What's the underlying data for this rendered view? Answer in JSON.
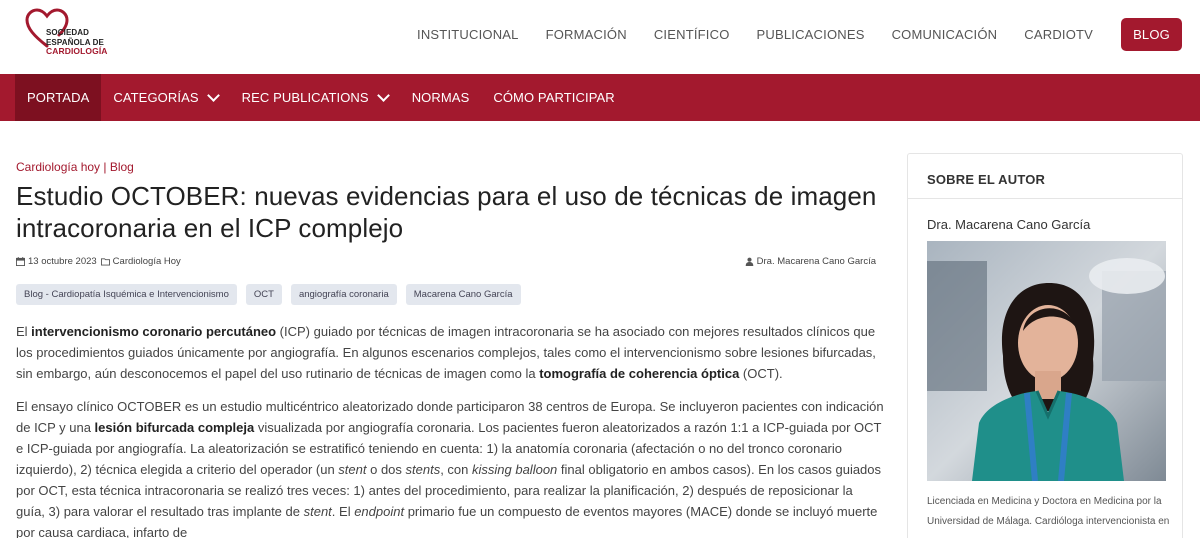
{
  "logo": {
    "line1": "SOCIEDAD",
    "line2": "ESPAÑOLA DE",
    "line3": "CARDIOLOGÍA",
    "icon": "heart-logo-icon",
    "color": "#a3192e"
  },
  "top_nav": {
    "items": [
      "INSTITUCIONAL",
      "FORMACIÓN",
      "CIENTÍFICO",
      "PUBLICACIONES",
      "COMUNICACIÓN",
      "CARDIOTV"
    ],
    "blog": "BLOG"
  },
  "main_nav": {
    "items": [
      "PORTADA",
      "CATEGORÍAS",
      "REC PUBLICATIONS",
      "NORMAS",
      "CÓMO PARTICIPAR"
    ],
    "active": "PORTADA",
    "bg_color": "#a3192e",
    "active_color": "#7d1020"
  },
  "article": {
    "categories": "Cardiología hoy | Blog",
    "title": "Estudio OCTOBER: nuevas evidencias para el uso de técnicas de imagen intracoronaria en el ICP complejo",
    "date": "13 octubre 2023",
    "category": "Cardiología Hoy",
    "author": "Dra. Macarena Cano García",
    "tags": [
      "Blog - Cardiopatía Isquémica e Intervencionismo",
      "OCT",
      "angiografía coronaria",
      "Macarena Cano García"
    ],
    "p1": {
      "s1": "El ",
      "b1": "intervencionismo coronario percutáneo",
      "s2": " (ICP) guiado por técnicas de imagen intracoronaria se ha asociado con mejores resultados clínicos que los procedimientos guiados únicamente por angiografía. En algunos escenarios complejos, tales como el intervencionismo sobre lesiones bifurcadas, sin embargo, aún desconocemos el papel del uso rutinario de técnicas de imagen como la ",
      "b2": "tomografía de coherencia óptica",
      "s3": " (OCT)."
    },
    "p2": {
      "s1": "El ensayo clínico OCTOBER es un estudio multicéntrico aleatorizado donde participaron 38 centros de Europa. Se incluyeron pacientes con indicación de ICP y una ",
      "b1": "lesión bifurcada compleja",
      "s2": " visualizada por angiografía coronaria. Los pacientes fueron aleatorizados a razón 1:1 a ICP-guiada por OCT e ICP-guiada por angiografía. La aleatorización se estratificó teniendo en cuenta: 1) la anatomía coronaria (afectación o no del tronco coronario izquierdo), 2) técnica elegida a criterio del operador (un ",
      "i1": "stent",
      "s3": " o dos ",
      "i2": "stents",
      "s4": ", con ",
      "i3": "kissing balloon",
      "s5": " final obligatorio en ambos casos). En los casos guiados por OCT, esta técnica intracoronaria se realizó tres veces: 1) antes del procedimiento, para realizar la planificación, 2) después de reposicionar la guía, 3) para valorar el resultado tras implante de ",
      "i4": "stent",
      "s6": ". El ",
      "i5": "endpoint",
      "s7": " primario fue un compuesto de eventos mayores (MACE) donde se incluyó muerte por causa cardiaca, infarto de"
    }
  },
  "sidebar": {
    "title": "SOBRE EL AUTOR",
    "name": "Dra. Macarena Cano García",
    "bio": "Licenciada en Medicina y Doctora en Medicina por la Universidad de Málaga. Cardióloga intervencionista en"
  }
}
